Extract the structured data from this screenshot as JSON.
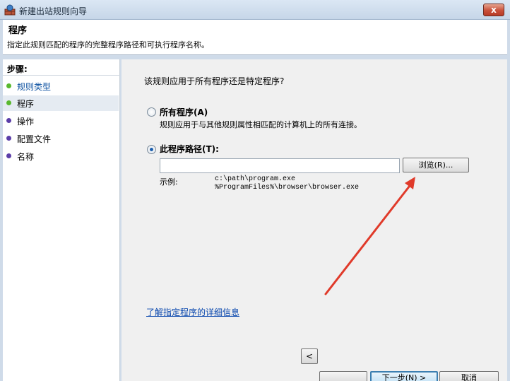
{
  "window": {
    "title": "新建出站规则向导",
    "close_label": "x"
  },
  "header": {
    "title": "程序",
    "subtitle": "指定此规则匹配的程序的完整程序路径和可执行程序名称。"
  },
  "steps": {
    "title": "步骤:",
    "items": [
      {
        "label": "规则类型",
        "state": "done"
      },
      {
        "label": "程序",
        "state": "current"
      },
      {
        "label": "操作",
        "state": "pending"
      },
      {
        "label": "配置文件",
        "state": "pending"
      },
      {
        "label": "名称",
        "state": "pending"
      }
    ]
  },
  "main": {
    "question": "该规则应用于所有程序还是特定程序?",
    "all_programs": {
      "label": "所有程序(A)",
      "description": "规则应用于与其他规则属性相匹配的计算机上的所有连接。",
      "checked": false
    },
    "this_program": {
      "label": "此程序路径(T):",
      "checked": true,
      "path_value": "",
      "browse_label": "浏览(R)..."
    },
    "example": {
      "label": "示例:",
      "paths": [
        "c:\\path\\program.exe",
        "%ProgramFiles%\\browser\\browser.exe"
      ]
    },
    "learn_more": "了解指定程序的详细信息"
  },
  "footer": {
    "back_label": "<",
    "next_label": "下一步(N) >",
    "cancel_label": "取消"
  },
  "colors": {
    "done_dot": "#58b82e",
    "pending_dot": "#5b3da8",
    "link": "#0645ad",
    "annotation_arrow": "#e03a2a"
  }
}
